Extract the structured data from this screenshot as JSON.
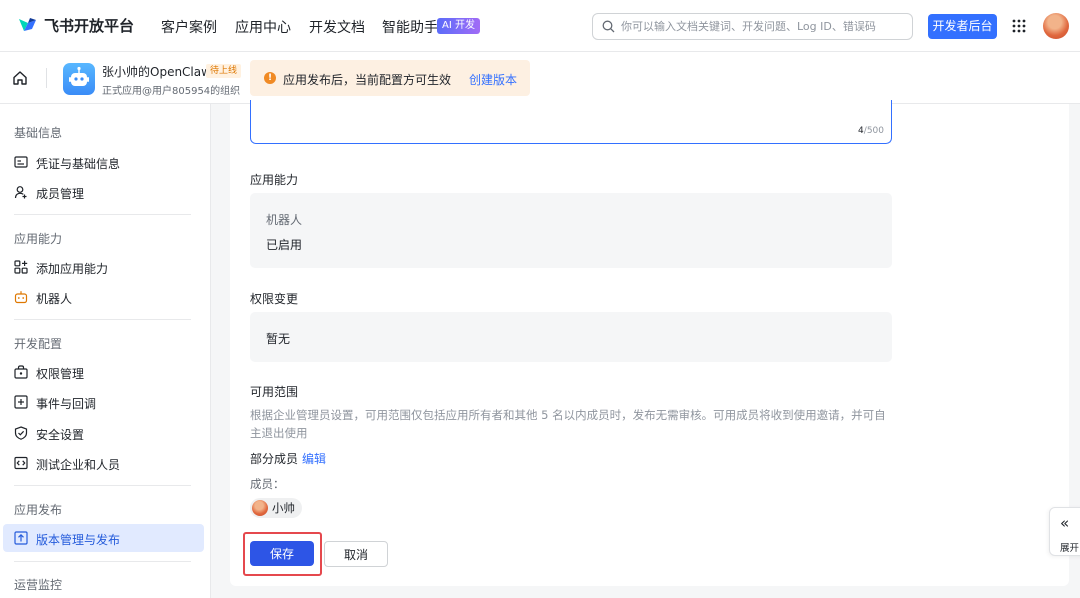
{
  "brand": {
    "name": "飞书开放平台"
  },
  "nav": {
    "items": [
      "客户案例",
      "应用中心",
      "开发文档",
      "智能助手"
    ],
    "ai_badge": "AI 开发",
    "search_placeholder": "你可以输入文档关键词、开发问题、Log ID、错误码",
    "dev_console": "开发者后台"
  },
  "app": {
    "name": "张小帅的OpenClaw",
    "status_badge": "待上线",
    "subtitle": "正式应用@用户805954的组织"
  },
  "notice": {
    "text": "应用发布后，当前配置方可生效",
    "link": "创建版本"
  },
  "sidebar": {
    "sections": [
      {
        "title": "基础信息",
        "items": [
          {
            "label": "凭证与基础信息",
            "icon": "credential-icon"
          },
          {
            "label": "成员管理",
            "icon": "member-icon"
          }
        ]
      },
      {
        "title": "应用能力",
        "items": [
          {
            "label": "添加应用能力",
            "icon": "add-capability-icon"
          },
          {
            "label": "机器人",
            "icon": "robot-icon"
          }
        ]
      },
      {
        "title": "开发配置",
        "items": [
          {
            "label": "权限管理",
            "icon": "permission-icon"
          },
          {
            "label": "事件与回调",
            "icon": "event-icon"
          },
          {
            "label": "安全设置",
            "icon": "shield-icon"
          },
          {
            "label": "测试企业和人员",
            "icon": "test-icon"
          }
        ]
      },
      {
        "title": "应用发布",
        "items": [
          {
            "label": "版本管理与发布",
            "icon": "upload-icon",
            "active": true
          }
        ]
      },
      {
        "title": "运营监控",
        "items": []
      }
    ]
  },
  "form": {
    "counter_current": "4",
    "counter_max": "/500",
    "capability": {
      "label": "应用能力",
      "name": "机器人",
      "status": "已启用"
    },
    "permission": {
      "label": "权限变更",
      "value": "暂无"
    },
    "scope": {
      "label": "可用范围",
      "hint": "根据企业管理员设置，可用范围仅包括应用所有者和其他 5 名以内成员时，发布无需审核。可用成员将收到使用邀请，并可自主退出使用",
      "mode": "部分成员",
      "edit": "编辑",
      "members_label": "成员：",
      "members": [
        "小帅"
      ]
    },
    "save": "保存",
    "cancel": "取消"
  },
  "expand": {
    "label": "展开"
  },
  "colors": {
    "primary": "#3370ff",
    "highlight": "#e5484d",
    "notice_bg": "#fdf0e2"
  }
}
